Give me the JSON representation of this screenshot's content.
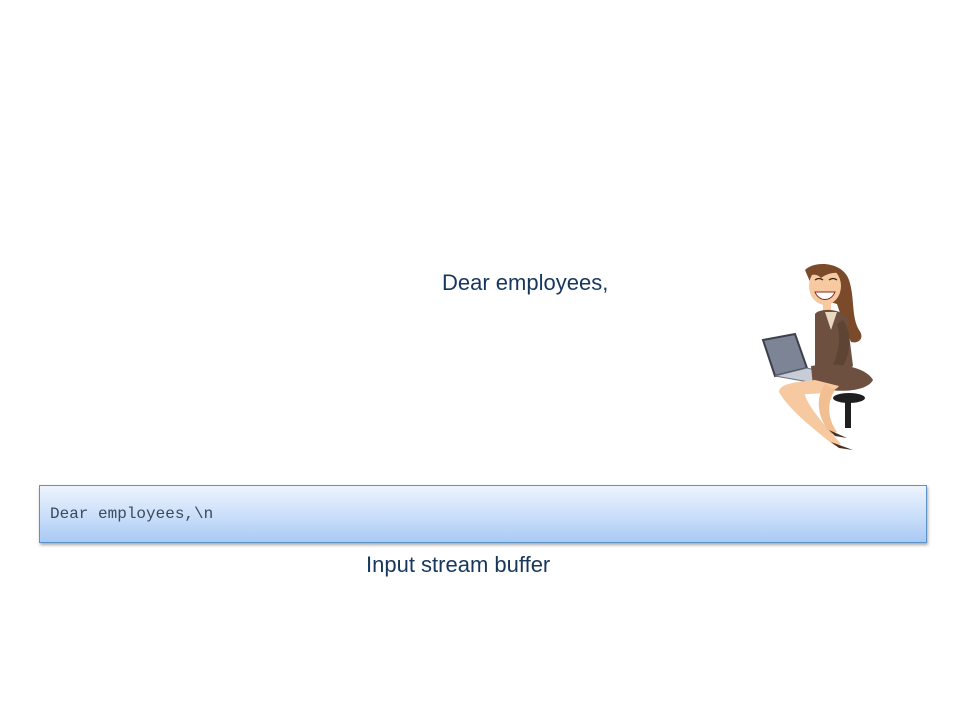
{
  "diagram": {
    "typed_text": "Dear employees,",
    "buffer_content": "Dear employees,\\n",
    "buffer_caption": "Input stream buffer",
    "illustration": "woman-typing-on-laptop",
    "colors": {
      "text": "#17375e",
      "buffer_top": "#edf4fd",
      "buffer_bottom": "#a9c9f5",
      "buffer_border": "#5b93c7"
    }
  }
}
